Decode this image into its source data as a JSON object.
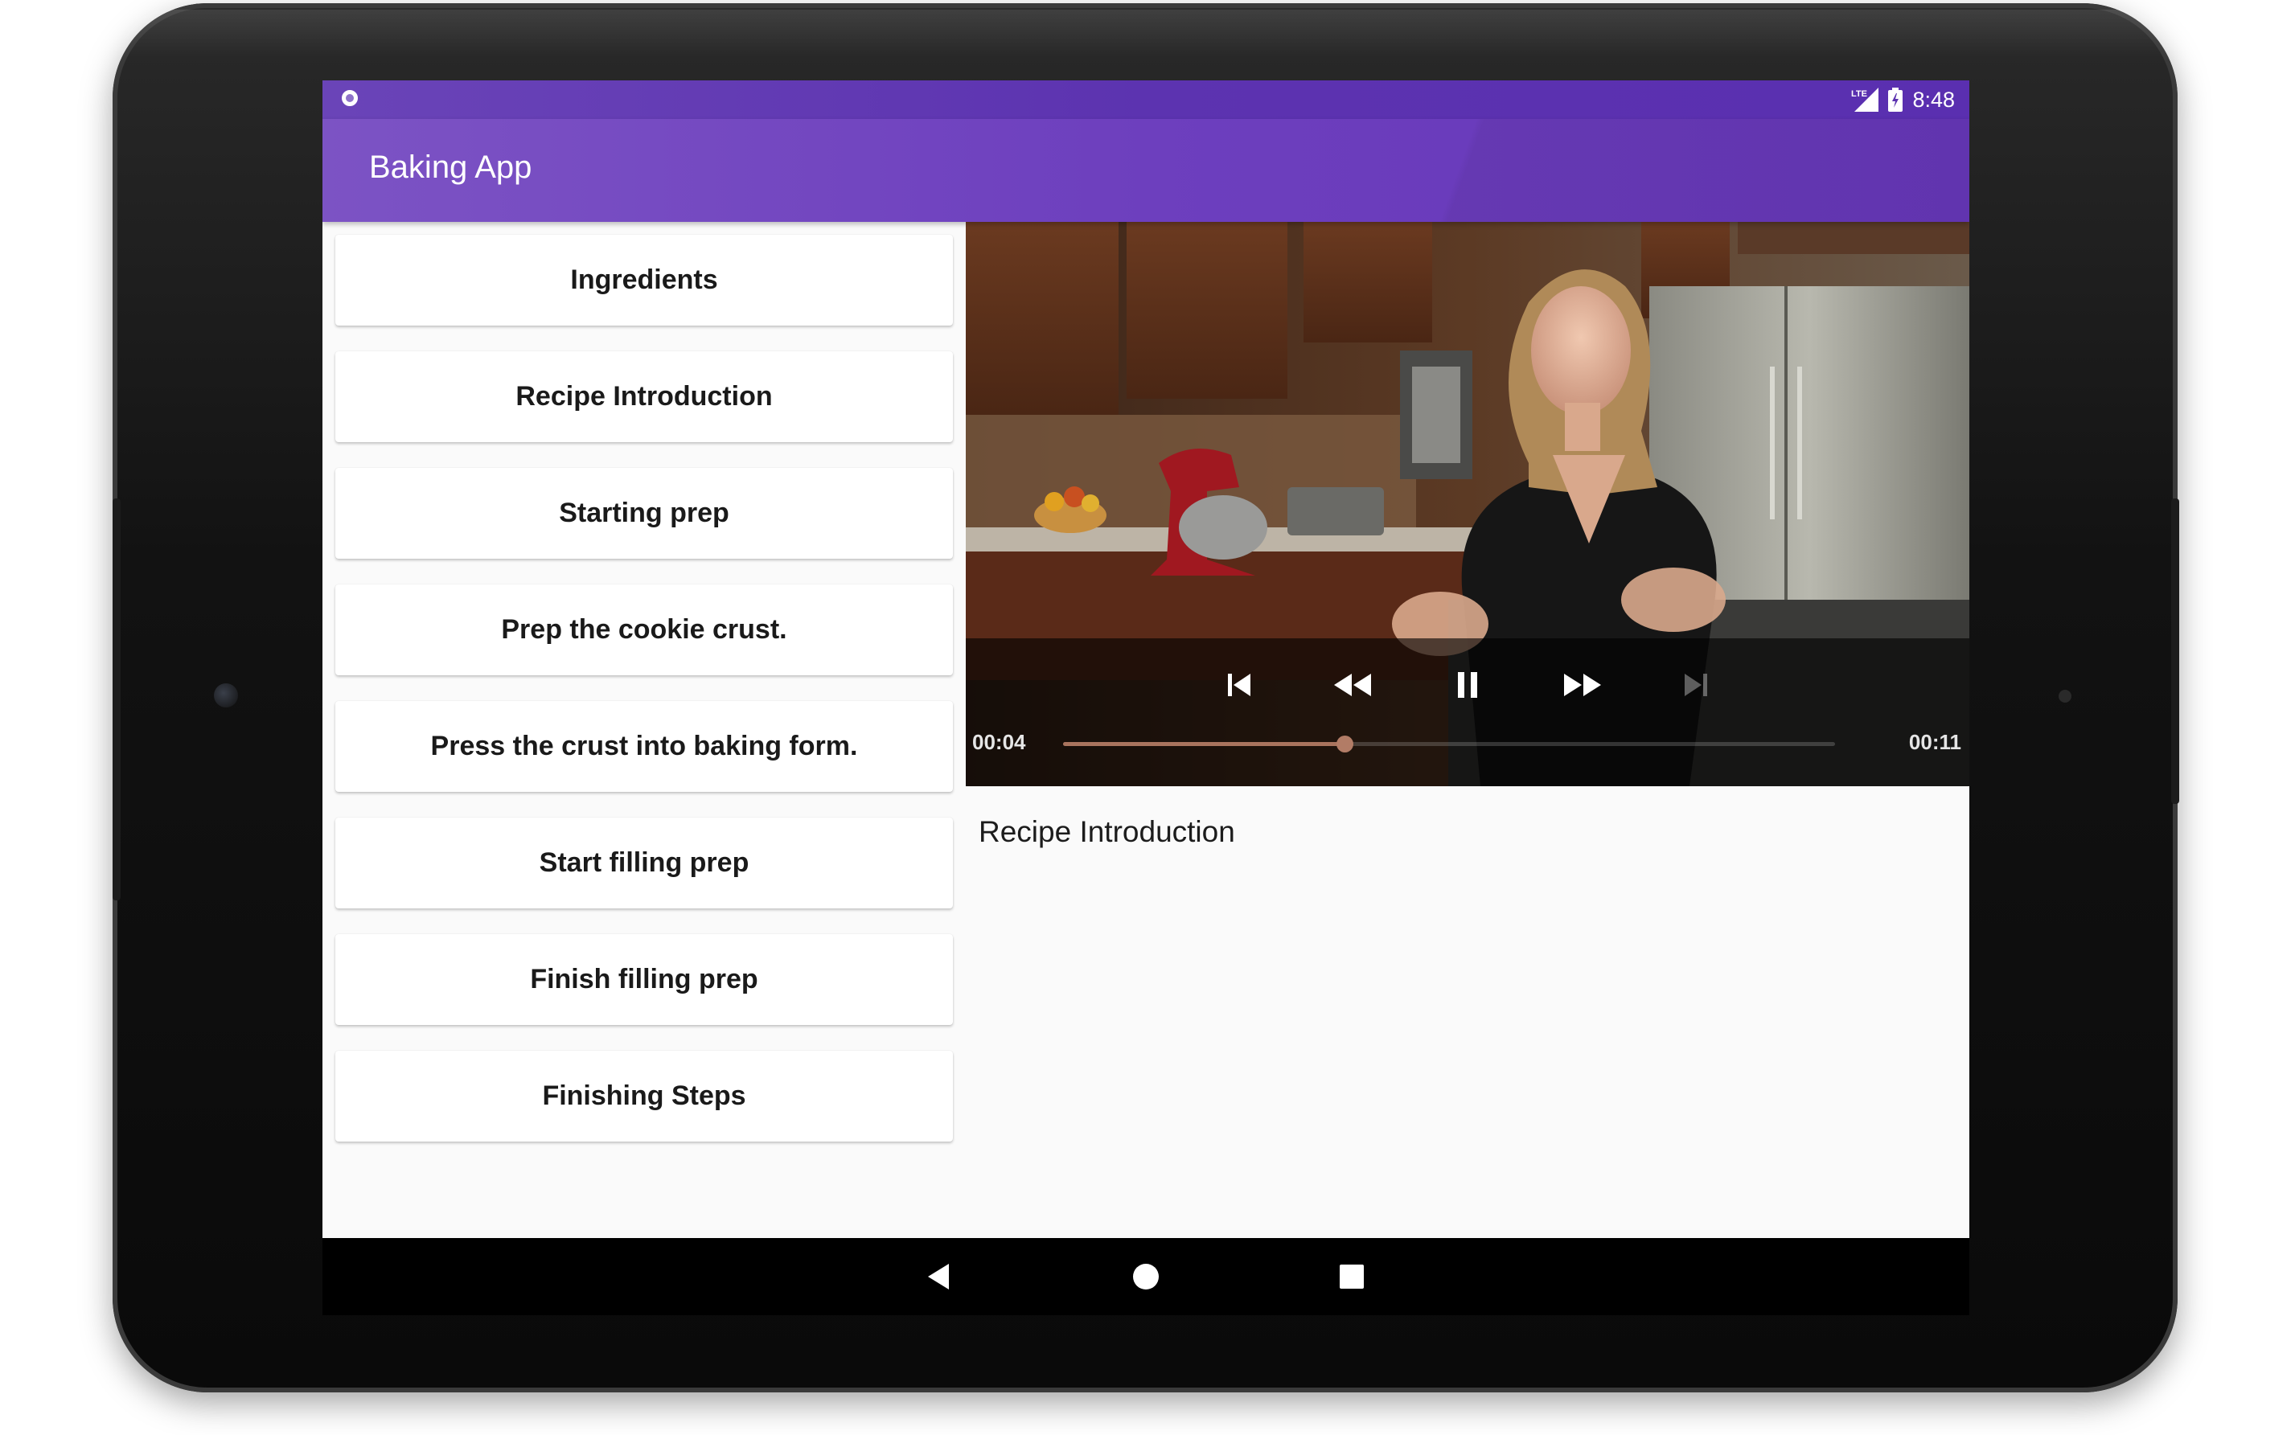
{
  "status_bar": {
    "time": "8:48",
    "network": "LTE",
    "icons": [
      "notification-circle-icon",
      "lte-signal-icon",
      "battery-charging-icon"
    ]
  },
  "app_bar": {
    "title": "Baking App",
    "color": "#6d3fbe"
  },
  "steps": {
    "items": [
      {
        "label": "Ingredients"
      },
      {
        "label": "Recipe Introduction"
      },
      {
        "label": "Starting prep"
      },
      {
        "label": "Prep the cookie crust."
      },
      {
        "label": "Press the crust into baking form."
      },
      {
        "label": "Start filling prep"
      },
      {
        "label": "Finish filling prep"
      },
      {
        "label": "Finishing Steps"
      }
    ]
  },
  "player": {
    "current_time": "00:04",
    "duration": "00:11",
    "progress": 0.365,
    "is_playing": true,
    "controls": [
      "skip-previous-icon",
      "rewind-icon",
      "pause-icon",
      "fast-forward-icon",
      "skip-next-icon"
    ],
    "accent": "#a9745e"
  },
  "detail": {
    "description": "Recipe Introduction"
  },
  "navigation": {
    "icons": [
      "back-icon",
      "home-icon",
      "recents-icon"
    ]
  }
}
